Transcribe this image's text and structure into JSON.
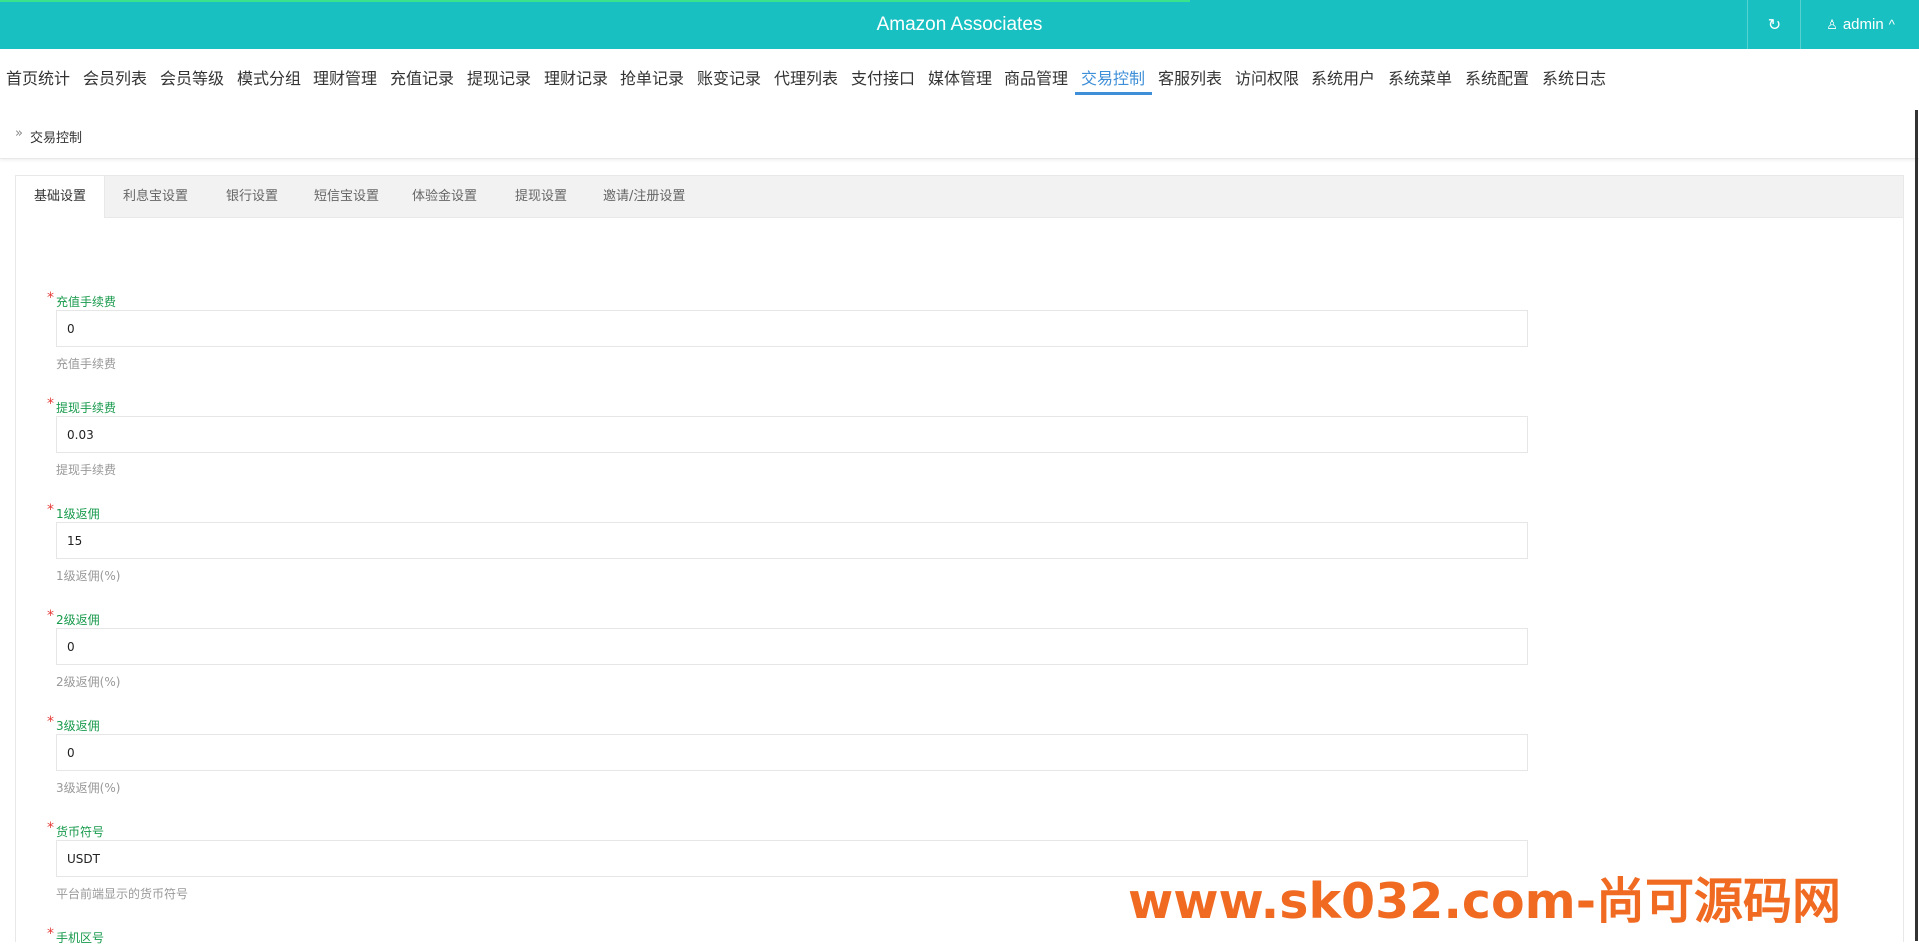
{
  "header": {
    "title": "Amazon Associates",
    "refresh_icon": "↻",
    "user_icon": "♙",
    "user_name": "admin",
    "caret_icon": "^",
    "bg_color": "#19c0c1",
    "loading_progress": 0.62
  },
  "nav": {
    "items": [
      "首页统计",
      "会员列表",
      "会员等级",
      "模式分组",
      "理财管理",
      "充值记录",
      "提现记录",
      "理财记录",
      "抢单记录",
      "账变记录",
      "代理列表",
      "支付接口",
      "媒体管理",
      "商品管理",
      "交易控制",
      "客服列表",
      "访问权限",
      "系统用户",
      "系统菜单",
      "系统配置",
      "系统日志"
    ],
    "active": "交易控制",
    "accent_color": "#3f8fd8"
  },
  "breadcrumb": {
    "icon": "»",
    "text": "交易控制"
  },
  "tabs": [
    "基础设置",
    "利息宝设置",
    "银行设置",
    "短信宝设置",
    "体验金设置",
    "提现设置",
    "邀请/注册设置"
  ],
  "form": {
    "required_mark": "*",
    "fields": [
      {
        "label": "充值手续费",
        "value": "0",
        "help": "充值手续费"
      },
      {
        "label": "提现手续费",
        "value": "0.03",
        "help": "提现手续费"
      },
      {
        "label": "1级返佣",
        "value": "15",
        "help": "1级返佣(%)"
      },
      {
        "label": "2级返佣",
        "value": "0",
        "help": "2级返佣(%)"
      },
      {
        "label": "3级返佣",
        "value": "0",
        "help": "3级返佣(%)"
      },
      {
        "label": "货币符号",
        "value": "USDT",
        "help": "平台前端显示的货币符号"
      },
      {
        "label": "手机区号",
        "value": "",
        "help": ""
      }
    ]
  },
  "watermark": "www.sk032.com-尚可源码网"
}
